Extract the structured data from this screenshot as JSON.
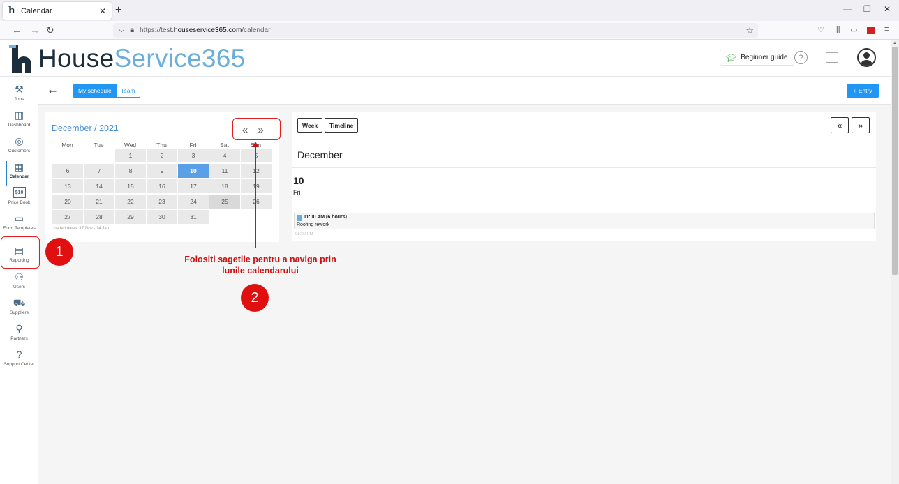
{
  "browser": {
    "tab_title": "Calendar",
    "new_tab": "+",
    "close": "✕",
    "url_prefix": "https://test.",
    "url_domain": "houseservice365.com",
    "url_path": "/calendar",
    "window_min": "—",
    "window_restore": "❐",
    "window_close": "✕"
  },
  "app": {
    "brand_a": "House",
    "brand_b": "Service365",
    "guide_label": "Beginner guide",
    "help_glyph": "?"
  },
  "sidebar": {
    "items": [
      {
        "label": "Jobs",
        "icon": "tools-icon",
        "glyph": "⚒"
      },
      {
        "label": "Dashboard",
        "icon": "bar-chart-icon",
        "glyph": "▥"
      },
      {
        "label": "Customers",
        "icon": "target-icon",
        "glyph": "◎"
      },
      {
        "label": "Calendar",
        "icon": "calendar-icon",
        "glyph": "▦"
      },
      {
        "label": "Price Book",
        "icon": "price-tag-icon",
        "glyph": "$10"
      },
      {
        "label": "Form Templates",
        "icon": "form-icon",
        "glyph": "▭"
      },
      {
        "label": "Reporting",
        "icon": "report-icon",
        "glyph": "▤"
      },
      {
        "label": "Users",
        "icon": "users-icon",
        "glyph": "⚇"
      },
      {
        "label": "Suppliers",
        "icon": "truck-icon",
        "glyph": "⛟"
      },
      {
        "label": "Partners",
        "icon": "network-icon",
        "glyph": "⚲"
      },
      {
        "label": "Support Center",
        "icon": "support-icon",
        "glyph": "?"
      }
    ]
  },
  "toolbar": {
    "back": "←",
    "my_schedule": "My schedule",
    "team": "Team",
    "entry": "+ Entry"
  },
  "mini_calendar": {
    "title": "December / 2021",
    "prev": "«",
    "next": "»",
    "weekdays": [
      "Mon",
      "Tue",
      "Wed",
      "Thu",
      "Fri",
      "Sat",
      "Sun"
    ],
    "weeks": [
      [
        "",
        "",
        "1",
        "2",
        "3",
        "4",
        "5"
      ],
      [
        "6",
        "7",
        "8",
        "9",
        "10",
        "11",
        "12"
      ],
      [
        "13",
        "14",
        "15",
        "16",
        "17",
        "18",
        "19"
      ],
      [
        "20",
        "21",
        "22",
        "23",
        "24",
        "25",
        "26"
      ],
      [
        "27",
        "28",
        "29",
        "30",
        "31",
        "",
        ""
      ]
    ],
    "today": "10",
    "loaded_dates": "Loaded dates: 17 Nov - 14 Jan"
  },
  "schedule": {
    "week_label": "Week",
    "timeline_label": "Timeline",
    "prev": "«",
    "next": "»",
    "month": "December",
    "day_number": "10",
    "day_name": "Fri",
    "event_time": "11:00 AM (6 hours)",
    "event_title": "Roofing rework",
    "ghost_time": "05:00 PM"
  },
  "annotations": {
    "badge_1": "1",
    "badge_2": "2",
    "note_line1": "Folositi sagetile pentru a naviga prin",
    "note_line2": "lunile calendarului",
    "color": "#e01010"
  }
}
